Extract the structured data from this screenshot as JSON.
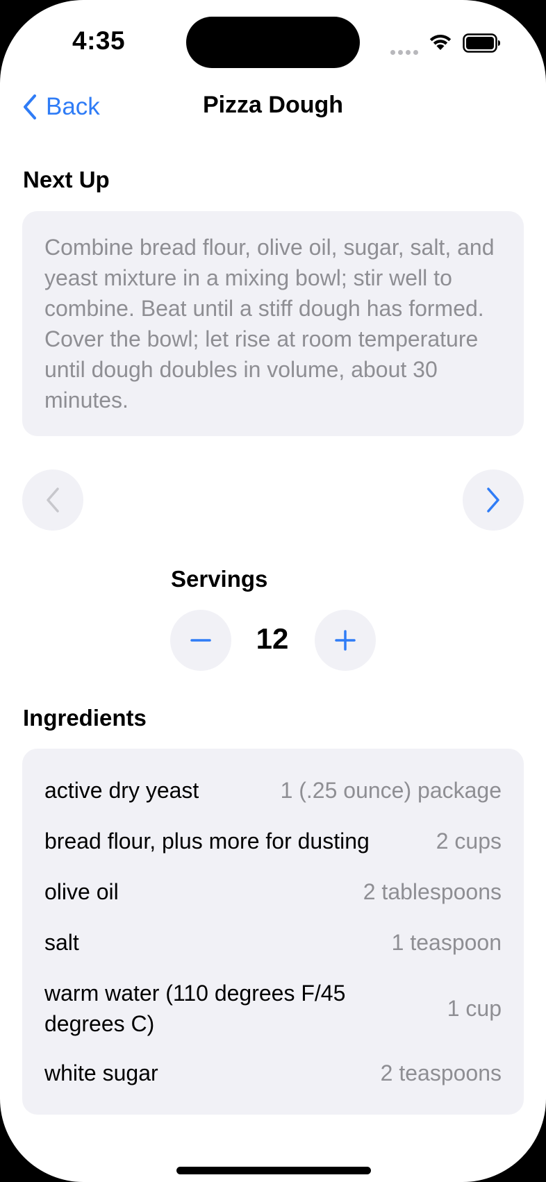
{
  "status_bar": {
    "time": "4:35"
  },
  "nav": {
    "back_label": "Back",
    "title": "Pizza Dough"
  },
  "next_up": {
    "title": "Next Up",
    "step_text": "Combine bread flour, olive oil, sugar, salt, and yeast mixture in a mixing bowl; stir well to combine. Beat until a stiff dough has formed. Cover the bowl; let rise at room temperature until dough doubles in volume, about 30 minutes."
  },
  "servings": {
    "label": "Servings",
    "value": "12"
  },
  "ingredients": {
    "title": "Ingredients",
    "items": [
      {
        "name": "active dry yeast",
        "amount": "1 (.25 ounce) package"
      },
      {
        "name": "bread flour, plus more for dusting",
        "amount": "2 cups"
      },
      {
        "name": "olive oil",
        "amount": "2 tablespoons"
      },
      {
        "name": "salt",
        "amount": "1 teaspoon"
      },
      {
        "name": "warm water (110 degrees F/45 degrees C)",
        "amount": "1 cup"
      },
      {
        "name": "white sugar",
        "amount": "2 teaspoons"
      }
    ]
  },
  "colors": {
    "accent": "#2f7cf6",
    "card_bg": "#f1f1f6",
    "secondary_text": "#8e8e93",
    "disabled": "#c7c7cc"
  },
  "icons": {
    "back": "chevron-left-icon",
    "prev_step": "chevron-left-icon",
    "next_step": "chevron-right-icon",
    "decrement": "minus-icon",
    "increment": "plus-icon"
  }
}
